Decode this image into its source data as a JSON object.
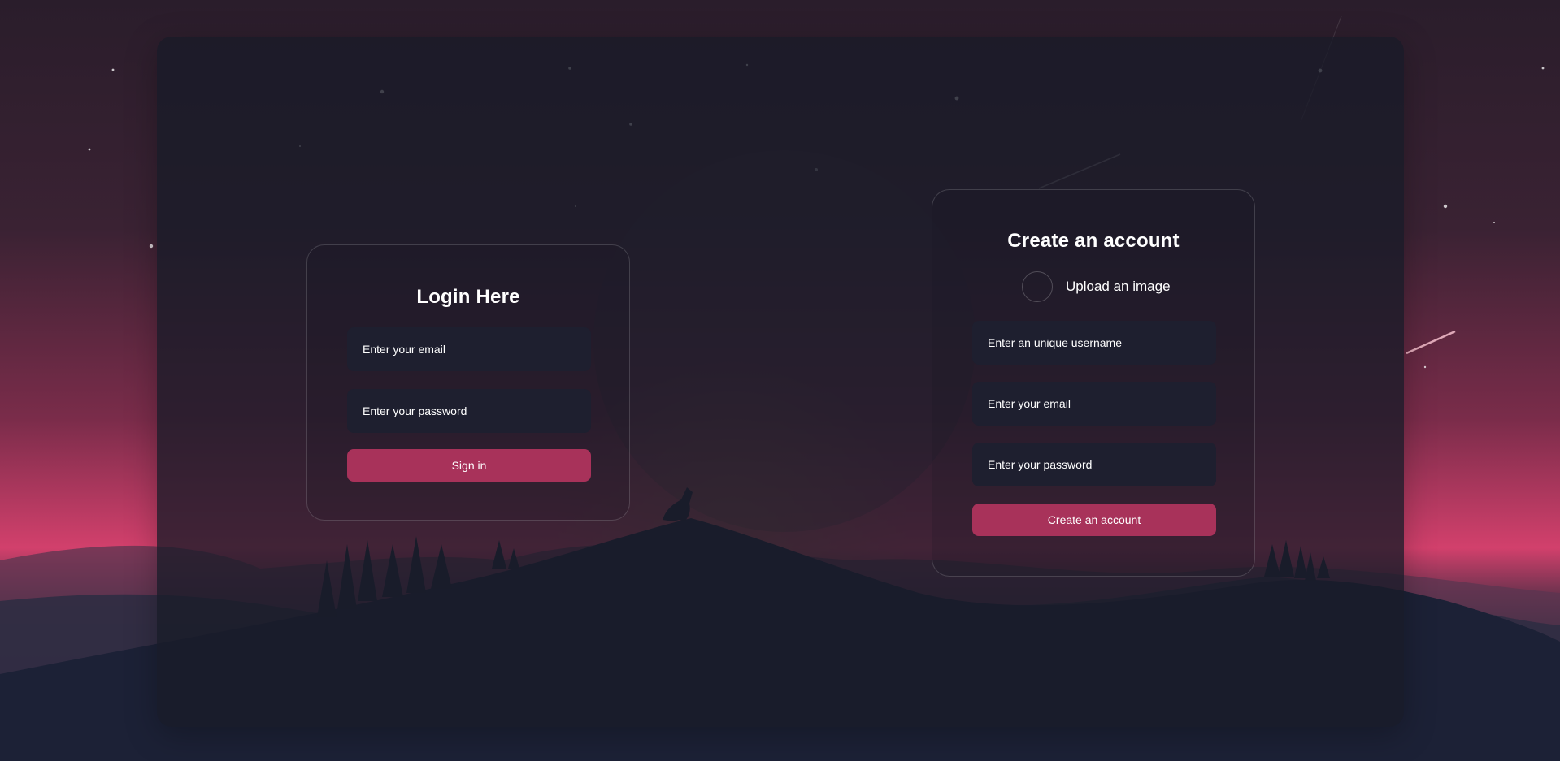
{
  "colors": {
    "accent": "#a8325a",
    "field_bg": "#1e1f2f",
    "panel_bg": "#181b28",
    "sky_pink": "#d2406c"
  },
  "login": {
    "title": "Login Here",
    "email_placeholder": "Enter your email",
    "password_placeholder": "Enter your password",
    "submit_label": "Sign in"
  },
  "signup": {
    "title": "Create an account",
    "upload_label": "Upload an image",
    "username_placeholder": "Enter an unique username",
    "email_placeholder": "Enter your email",
    "password_placeholder": "Enter your password",
    "submit_label": "Create an account"
  }
}
